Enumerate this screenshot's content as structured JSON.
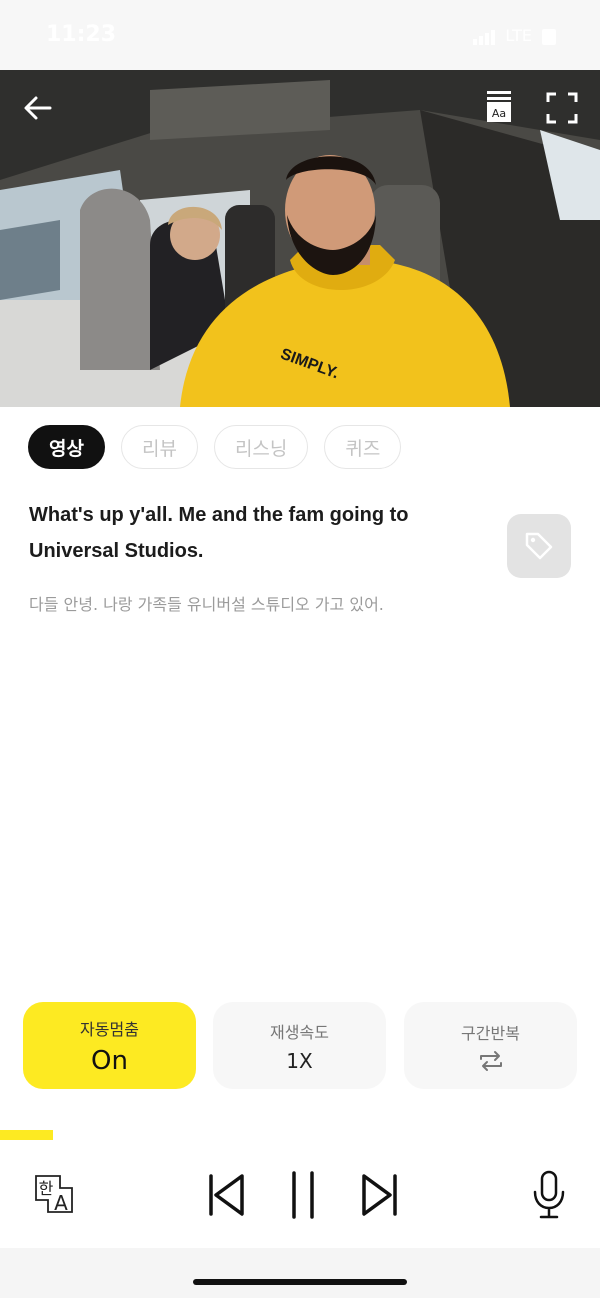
{
  "status_bar": {
    "time": "11:23",
    "network": "LTE"
  },
  "player": {
    "progress_fraction": 0.088,
    "back_icon": "arrow-left-icon",
    "subtitle_icon": "subtitle-aa-icon",
    "fullscreen_icon": "fullscreen-icon"
  },
  "tabs": [
    {
      "label": "영상",
      "active": true
    },
    {
      "label": "리뷰",
      "active": false
    },
    {
      "label": "리스닝",
      "active": false
    },
    {
      "label": "퀴즈",
      "active": false
    }
  ],
  "subtitle": {
    "english": "What's up y'all. Me and the fam going to Universal Studios.",
    "korean": "다들 안녕. 나랑 가족들 유니버설 스튜디오 가고 있어.",
    "tag_icon": "tag-icon"
  },
  "controls": {
    "auto_stop": {
      "label": "자동멈춤",
      "value": "On"
    },
    "speed": {
      "label": "재생속도",
      "value": "1X"
    },
    "repeat": {
      "label": "구간반복",
      "icon": "repeat-icon"
    }
  },
  "bottom_bar": {
    "translate_icon": "korean-english-translate-icon",
    "translate_glyph_ko": "한",
    "translate_glyph_en": "A",
    "prev_icon": "skip-previous-icon",
    "pause_icon": "pause-icon",
    "next_icon": "skip-next-icon",
    "mic_icon": "microphone-icon"
  },
  "colors": {
    "accent": "#fdea22",
    "active_tab": "#111111",
    "hoodie": "#f2c21c"
  }
}
